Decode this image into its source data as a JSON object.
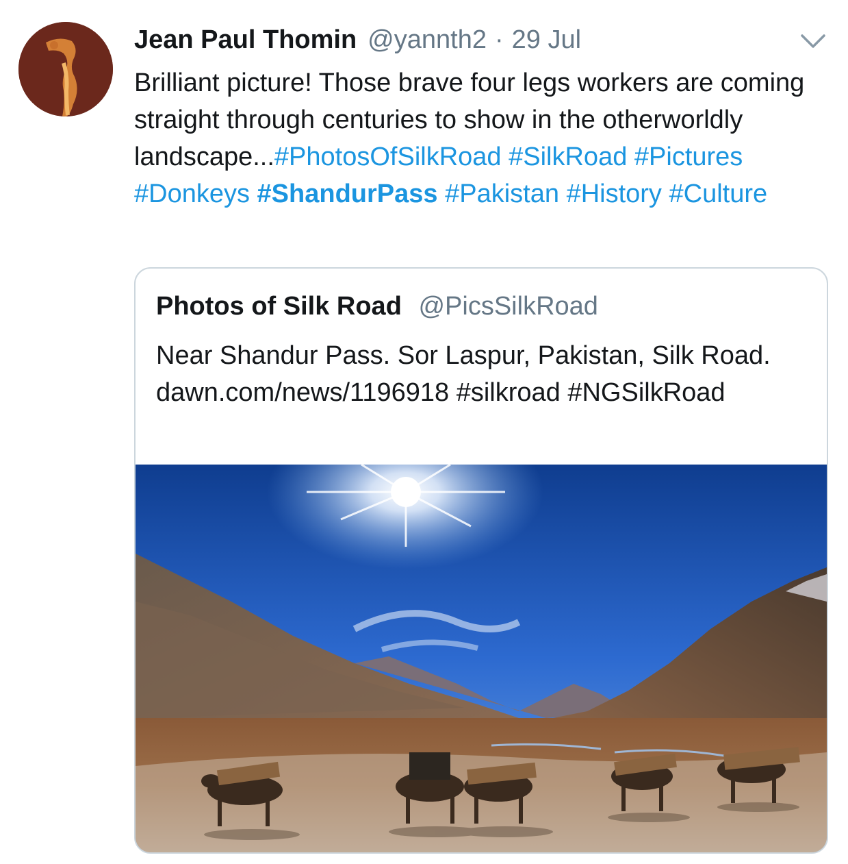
{
  "tweet": {
    "author_name": "Jean Paul Thomin",
    "author_handle": "@yannth2",
    "separator": "·",
    "timestamp": "29 Jul",
    "avatar_icon": "avatar-image",
    "menu_icon": "chevron-down-icon",
    "text_plain": "Brilliant picture! Those brave four legs workers are coming straight through centuries to show in the otherworldly landscape...",
    "hashtags": [
      "#PhotosOfSilkRoad",
      "#SilkRoad",
      "#Pictures",
      "#Donkeys",
      "#ShandurPass",
      "#Pakistan",
      "#History",
      "#Culture"
    ]
  },
  "quoted_tweet": {
    "author_name": "Photos of Silk Road",
    "author_handle": "@PicsSilkRoad",
    "text": "Near Shandur Pass. Sor Laspur, Pakistan, Silk Road.",
    "link": "dawn.com/news/1196918",
    "hashtags": [
      "#silkroad",
      "#NGSilkRoad"
    ],
    "image_description_icon": "landscape-photo"
  },
  "colors": {
    "link": "#1b95e0",
    "secondary_text": "#657786",
    "primary_text": "#14171a",
    "border": "#ccd6dd"
  }
}
